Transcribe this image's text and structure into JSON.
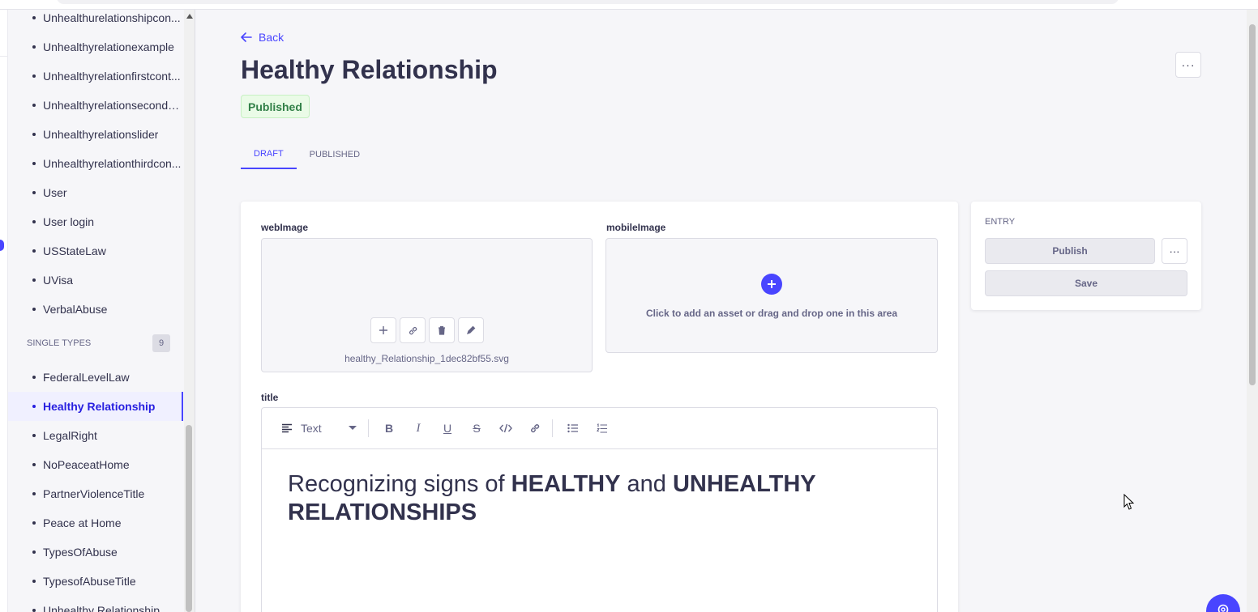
{
  "sidebar": {
    "items_top": [
      "Unhealthurelationshipcon...",
      "Unhealthyrelationexample",
      "Unhealthyrelationfirstcont...",
      "Unhealthyrelationsecondc...",
      "Unhealthyrelationslider",
      "Unhealthyrelationthirdcon...",
      "User",
      "User login",
      "USStateLaw",
      "UVisa",
      "VerbalAbuse"
    ],
    "section_label": "SINGLE TYPES",
    "section_count": "9",
    "items_single": [
      "FederalLevelLaw",
      "Healthy Relationship",
      "LegalRight",
      "NoPeaceatHome",
      "PartnerViolenceTitle",
      "Peace at Home",
      "TypesOfAbuse",
      "TypesofAbuseTitle",
      "Unhealthy Relationship"
    ],
    "active_item": "Healthy Relationship"
  },
  "header": {
    "back_label": "Back",
    "title": "Healthy Relationship",
    "status_badge": "Published",
    "more_label": "···"
  },
  "tabs": [
    {
      "label": "DRAFT",
      "active": true
    },
    {
      "label": "PUBLISHED",
      "active": false
    }
  ],
  "form": {
    "web_image": {
      "label": "webImage",
      "filename": "healthy_Relationship_1dec82bf55.svg"
    },
    "mobile_image": {
      "label": "mobileImage",
      "empty_text": "Click to add an asset or drag and drop one in this area"
    },
    "title": {
      "label": "title",
      "block_type": "Text",
      "content_parts": [
        {
          "text": "Recognizing signs of ",
          "bold": false
        },
        {
          "text": "HEALTHY",
          "bold": true
        },
        {
          "text": " and ",
          "bold": false
        },
        {
          "text": "UNHEALTHY RELATIONSHIPS",
          "bold": true
        }
      ]
    }
  },
  "entry_panel": {
    "heading": "ENTRY",
    "publish_label": "Publish",
    "more_label": "···",
    "save_label": "Save"
  },
  "colors": {
    "primary": "#4945ff",
    "success_text": "#328048",
    "success_bg": "#eafbe7",
    "text": "#32324d",
    "muted": "#666687"
  }
}
